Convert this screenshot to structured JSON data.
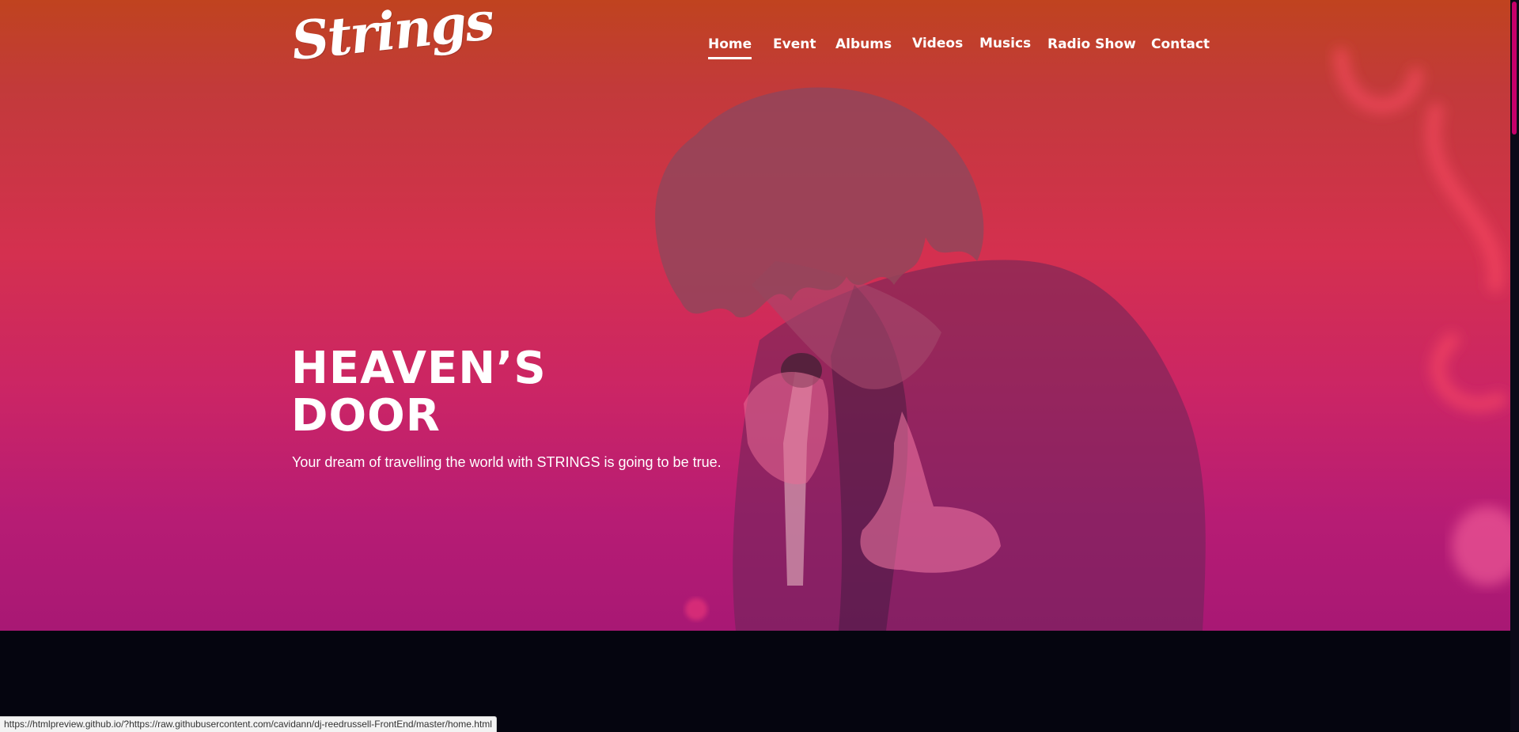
{
  "logo": {
    "text": "Strings"
  },
  "nav": {
    "items": [
      {
        "label": "Home",
        "active": true
      },
      {
        "label": "Event"
      },
      {
        "label": "Albums"
      },
      {
        "label": "Videos"
      },
      {
        "label": "Musics"
      },
      {
        "label": "Radio Show"
      },
      {
        "label": "Contact"
      }
    ]
  },
  "hero": {
    "title_line1": "HEAVEN’S",
    "title_line2": "DOOR",
    "subtitle": "Your dream of travelling the world with STRINGS is going to be true."
  },
  "status_bar": {
    "url": "https://htmlpreview.github.io/?https://raw.githubusercontent.com/cavidann/dj-reedrussell-FrontEnd/master/home.html"
  },
  "colors": {
    "hero_top": "#c0431f",
    "hero_bottom": "#a81874",
    "page_background": "#05050f",
    "scroll_thumb": "#c6006a"
  }
}
